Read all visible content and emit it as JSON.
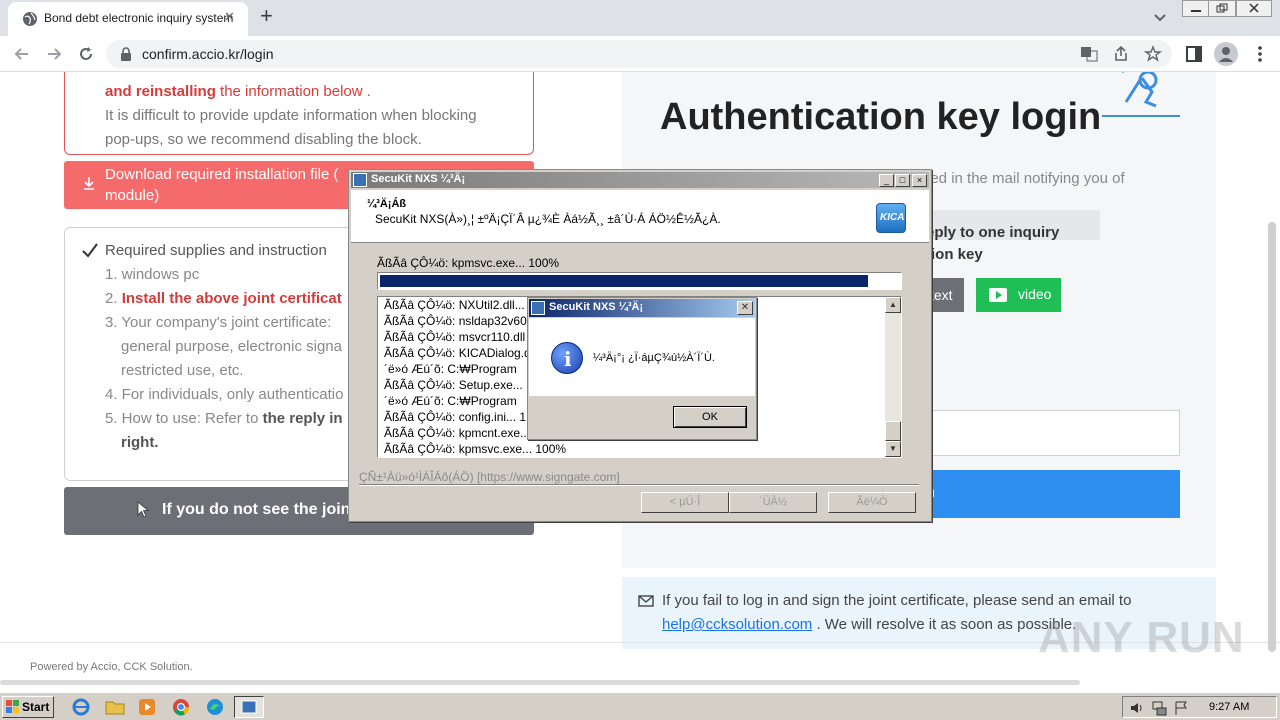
{
  "browser": {
    "tab_title": "Bond debt electronic inquiry system",
    "tab_close": "✕",
    "new_tab": "+",
    "url": "confirm.accio.kr/login"
  },
  "left": {
    "notice_red": "and reinstalling",
    "notice_rest": " the information below .",
    "notice_l2": "It is difficult to provide update information when blocking",
    "notice_l3": "pop-ups, so we recommend disabling the block.",
    "download_l1": "Download required installation file (",
    "download_l2": "module)",
    "req_title": "Required supplies and instruction",
    "req_items": [
      "1. windows pc",
      "2. ",
      "Install the above joint certificat",
      "3. Your company's joint certificate:",
      "general purpose, electronic signa",
      "restricted use, etc.",
      "4. For individuals, only authenticatio",
      "5. How to use: Refer to ",
      "the reply in",
      "right."
    ],
    "dark_button": "If you do not see the joint"
  },
  "right": {
    "title": "Authentication key login",
    "desc": "ded in the mail notifying you of",
    "reply_l1": "eply to one inquiry",
    "reply_l2": "tion key",
    "text_button": "text",
    "video_button": "video",
    "login_button": "n"
  },
  "email": {
    "line1": "If you fail to log in and sign the joint certificate, please send an email to",
    "link": "help@ccksolution.com",
    "line2_rest": " . We will resolve it as soon as possible."
  },
  "footer": "Powered by Accio, CCK Solution.",
  "watermark": "ANY RUN",
  "dialog": {
    "title": "SecuKit NXS ¼³Ä¡",
    "header_title": "¼³Ä¡Áß",
    "header_sub": "SecuKit NXS(À»)¸¦ ±ºÄ¡ÇÏ´Â µ¿¾È Àá½Ã¸¸ ±â´Ù·Á ÁÖ½Ê½Ã¿À.",
    "logo": "KICA",
    "status": "ÃßÃâ ÇÔ¼ö: kpmsvc.exe... 100%",
    "progress": 0.94,
    "log": [
      "ÃßÃâ ÇÔ¼ö: NXUtil2.dll...",
      "ÃßÃâ ÇÔ¼ö: nsldap32v60",
      "ÃßÃâ ÇÔ¼ö: msvcr110.dll",
      "ÃßÃâ ÇÔ¼ö: KICADialog.d",
      "´ë»ó Æú´õ: C:₩Program",
      "ÃßÃâ ÇÔ¼ö: Setup.exe...",
      "´ë»ó Æú´õ: C:₩Program",
      "ÃßÃâ ÇÔ¼ö: config.ini... 1",
      "ÃßÃâ ÇÔ¼ö: kpmcnt.exe...",
      "ÃßÃâ ÇÔ¼ö: kpmsvc.exe... 100%"
    ],
    "footer": "ÇÑ±¹Àü»ó¹ÌÀÎÁõ(ÁÖ) [https://www.signgate.com]",
    "btn_back": "< µÚ·Î",
    "btn_next": "´ÙÀ½",
    "btn_cancel": "Ãë¼Ò"
  },
  "msgbox": {
    "title": "SecuKit NXS ¼³Ä¡",
    "close": "✕",
    "text": "¼³Ä¡°¡ ¿Ï·áµÇ¾ú½À´Ï´Ù.",
    "ok": "OK"
  },
  "taskbar": {
    "start": "Start",
    "clock": "9:27 AM"
  }
}
